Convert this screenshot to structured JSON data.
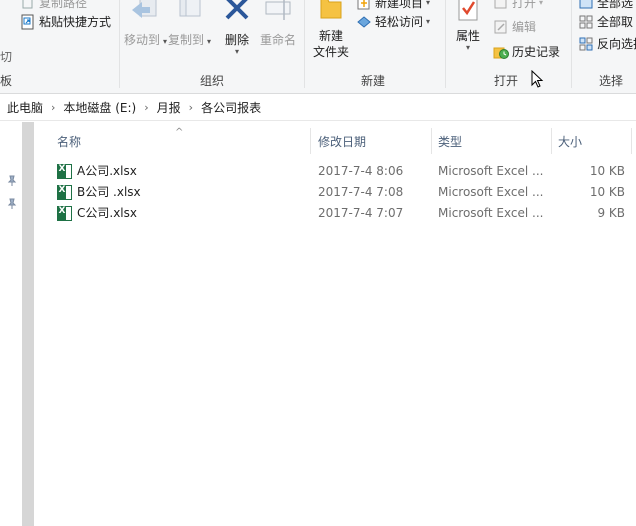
{
  "ribbon": {
    "clipboard": {
      "copy_path": "复制路径",
      "paste_shortcut": "粘贴快捷方式",
      "cut_partial": "切",
      "group_partial": "板"
    },
    "organize": {
      "label": "组织",
      "move_to": "移动到",
      "copy_to": "复制到",
      "delete": "删除",
      "rename": "重命名"
    },
    "new": {
      "label": "新建",
      "new_folder_line1": "新建",
      "new_folder_line2": "文件夹",
      "new_item": "新建项目",
      "easy_access": "轻松访问"
    },
    "open": {
      "label": "打开",
      "properties": "属性",
      "open": "打开",
      "edit": "编辑",
      "history": "历史记录"
    },
    "select": {
      "label": "选择",
      "select_all": "全部选",
      "select_none": "全部取",
      "invert": "反向选择"
    }
  },
  "address": {
    "crumbs": [
      "此电脑",
      "本地磁盘 (E:)",
      "月报",
      "各公司报表"
    ]
  },
  "columns": {
    "name": "名称",
    "date": "修改日期",
    "type": "类型",
    "size": "大小"
  },
  "files": [
    {
      "name": "A公司.xlsx",
      "date": "2017-7-4 8:06",
      "type": "Microsoft Excel ...",
      "size": "10 KB"
    },
    {
      "name": "B公司 .xlsx",
      "date": "2017-7-4 7:08",
      "type": "Microsoft Excel ...",
      "size": "10 KB"
    },
    {
      "name": "C公司.xlsx",
      "date": "2017-7-4 7:07",
      "type": "Microsoft Excel ...",
      "size": "9 KB"
    }
  ],
  "colors": {
    "ribbon_bg": "#f5f6f7",
    "header_text": "#4c607a",
    "excel_green": "#1e7145",
    "accent_blue": "#1979ca",
    "delete_blue": "#2b579a",
    "history_green": "#4caf50"
  },
  "icons": [
    "paste-shortcut-icon",
    "move-to-icon",
    "copy-to-icon",
    "delete-icon",
    "rename-icon",
    "new-folder-icon",
    "new-item-icon",
    "easy-access-icon",
    "properties-icon",
    "open-icon",
    "edit-icon",
    "history-icon",
    "select-all-icon",
    "select-none-icon",
    "invert-selection-icon",
    "pin-icon",
    "excel-file-icon",
    "mouse-cursor-icon"
  ]
}
